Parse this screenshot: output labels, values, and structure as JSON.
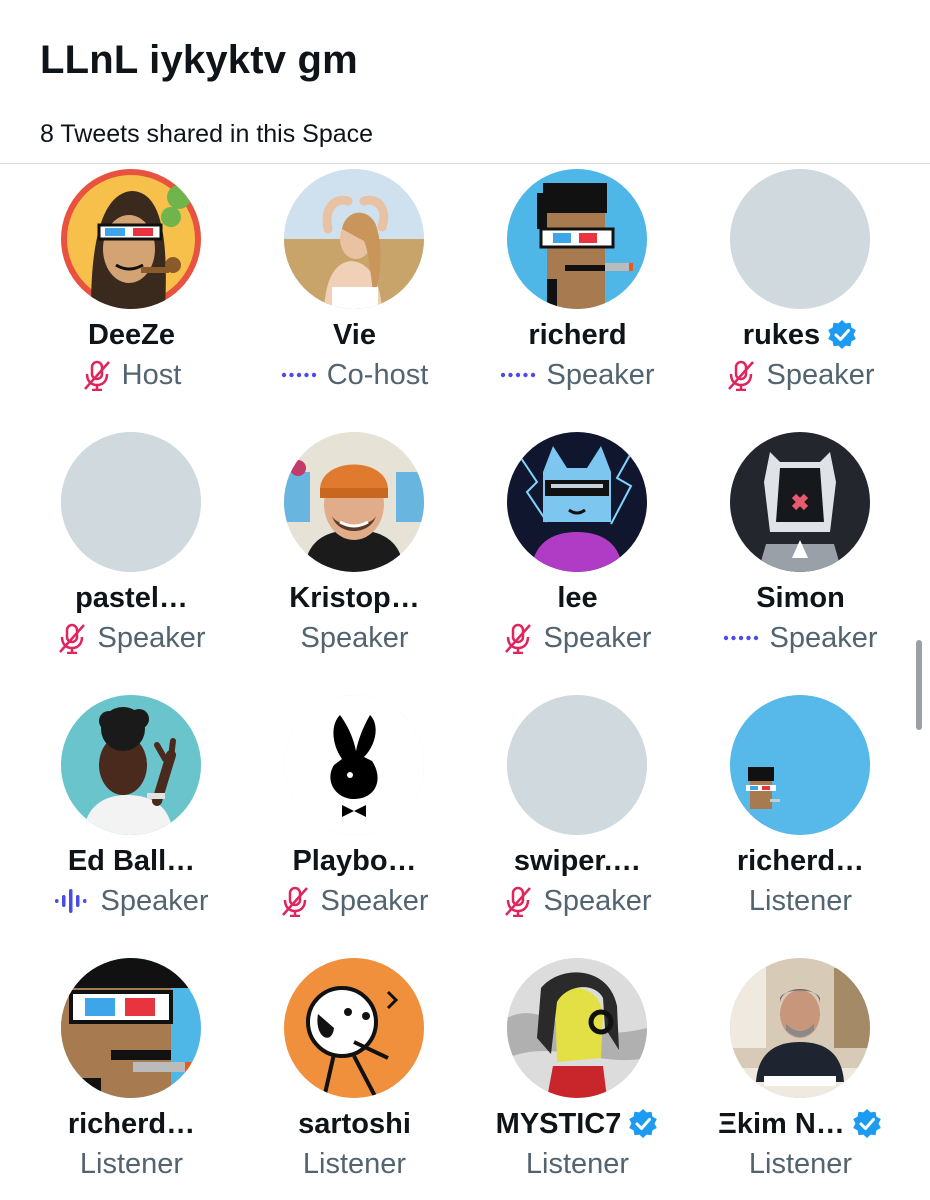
{
  "space": {
    "title": "LLnL iykyktv gm",
    "tweets_shared": "8 Tweets shared in this Space"
  },
  "colors": {
    "muted_icon": "#e0245e",
    "speaking_dots": "#4b4be8",
    "verified": "#1d9bf0",
    "role_text": "#536471",
    "placeholder_avatar": "#cfd9de"
  },
  "participants": [
    {
      "name": "DeeZe",
      "role": "Host",
      "status": "muted",
      "verified": false,
      "avatar": "ape-3d-glasses"
    },
    {
      "name": "Vie",
      "role": "Co-host",
      "status": "dots",
      "verified": false,
      "avatar": "photo-woman-field"
    },
    {
      "name": "richerd",
      "role": "Speaker",
      "status": "dots",
      "verified": false,
      "avatar": "punk-3d-glasses"
    },
    {
      "name": "rukes",
      "role": "Speaker",
      "status": "muted",
      "verified": true,
      "avatar": "placeholder"
    },
    {
      "name": "pastel…",
      "role": "Speaker",
      "status": "muted",
      "verified": false,
      "avatar": "placeholder"
    },
    {
      "name": "Kristop…",
      "role": "Speaker",
      "status": "none",
      "verified": false,
      "avatar": "photo-man-beanie"
    },
    {
      "name": "lee",
      "role": "Speaker",
      "status": "muted",
      "verified": false,
      "avatar": "cat-lightning"
    },
    {
      "name": "Simon",
      "role": "Speaker",
      "status": "dots",
      "verified": false,
      "avatar": "robot-helmet"
    },
    {
      "name": "Ed Ball…",
      "role": "Speaker",
      "status": "speaking",
      "verified": false,
      "avatar": "photo-man-blue"
    },
    {
      "name": "Playbo…",
      "role": "Speaker",
      "status": "muted",
      "verified": false,
      "avatar": "playboy-bunny"
    },
    {
      "name": "swiper.…",
      "role": "Speaker",
      "status": "muted",
      "verified": false,
      "avatar": "placeholder"
    },
    {
      "name": "richerd…",
      "role": "Listener",
      "status": "none",
      "verified": false,
      "avatar": "small-punk-blue"
    },
    {
      "name": "richerd…",
      "role": "Listener",
      "status": "none",
      "verified": false,
      "avatar": "punk-closeup"
    },
    {
      "name": "sartoshi",
      "role": "Listener",
      "status": "none",
      "verified": false,
      "avatar": "sartoshi-drawing"
    },
    {
      "name": "MYSTIC7",
      "role": "Listener",
      "status": "none",
      "verified": true,
      "avatar": "anime-yellow"
    },
    {
      "name": "Ξkim N…",
      "role": "Listener",
      "status": "none",
      "verified": true,
      "avatar": "photo-man-desk"
    }
  ]
}
